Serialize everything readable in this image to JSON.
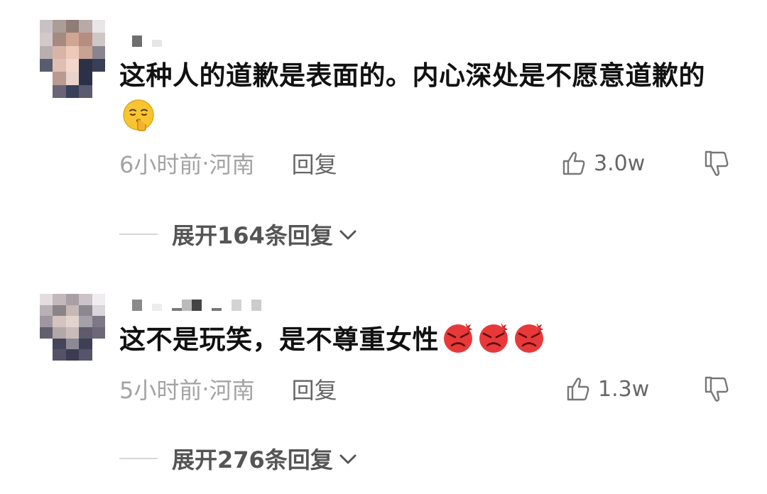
{
  "comments": [
    {
      "text": "这种人的道歉是表面的。内心深处是不愿意道歉的",
      "emoji": "shushing-face-emoji",
      "time": "6小时前",
      "location": "河南",
      "reply_label": "回复",
      "likes": "3.0w",
      "expand_label": "展开164条回复"
    },
    {
      "text": "这不是玩笑，是不尊重女性",
      "emoji": "angry-face-emoji",
      "emoji_count": 3,
      "time": "5小时前",
      "location": "河南",
      "reply_label": "回复",
      "likes": "1.3w",
      "expand_label": "展开276条回复"
    }
  ],
  "meta_separator": " · ",
  "colors": {
    "text": "#111111",
    "meta": "#a3a3a3",
    "reply": "#666666",
    "emoji_yellow": "#f8c530",
    "emoji_red": "#e8393a"
  }
}
